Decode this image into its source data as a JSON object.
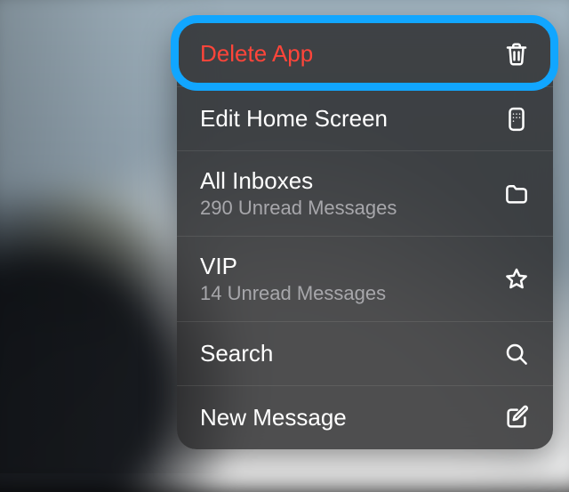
{
  "menu": {
    "delete": {
      "label": "Delete App"
    },
    "edit_home": {
      "label": "Edit Home Screen"
    },
    "all_inboxes": {
      "label": "All Inboxes",
      "subtitle": "290 Unread Messages"
    },
    "vip": {
      "label": "VIP",
      "subtitle": "14 Unread Messages"
    },
    "search": {
      "label": "Search"
    },
    "new_message": {
      "label": "New Message"
    }
  },
  "colors": {
    "danger": "#ff453a",
    "highlight": "#11a6ff",
    "panel": "rgba(40,40,42,0.82)",
    "text_secondary": "#a7a7ab"
  }
}
